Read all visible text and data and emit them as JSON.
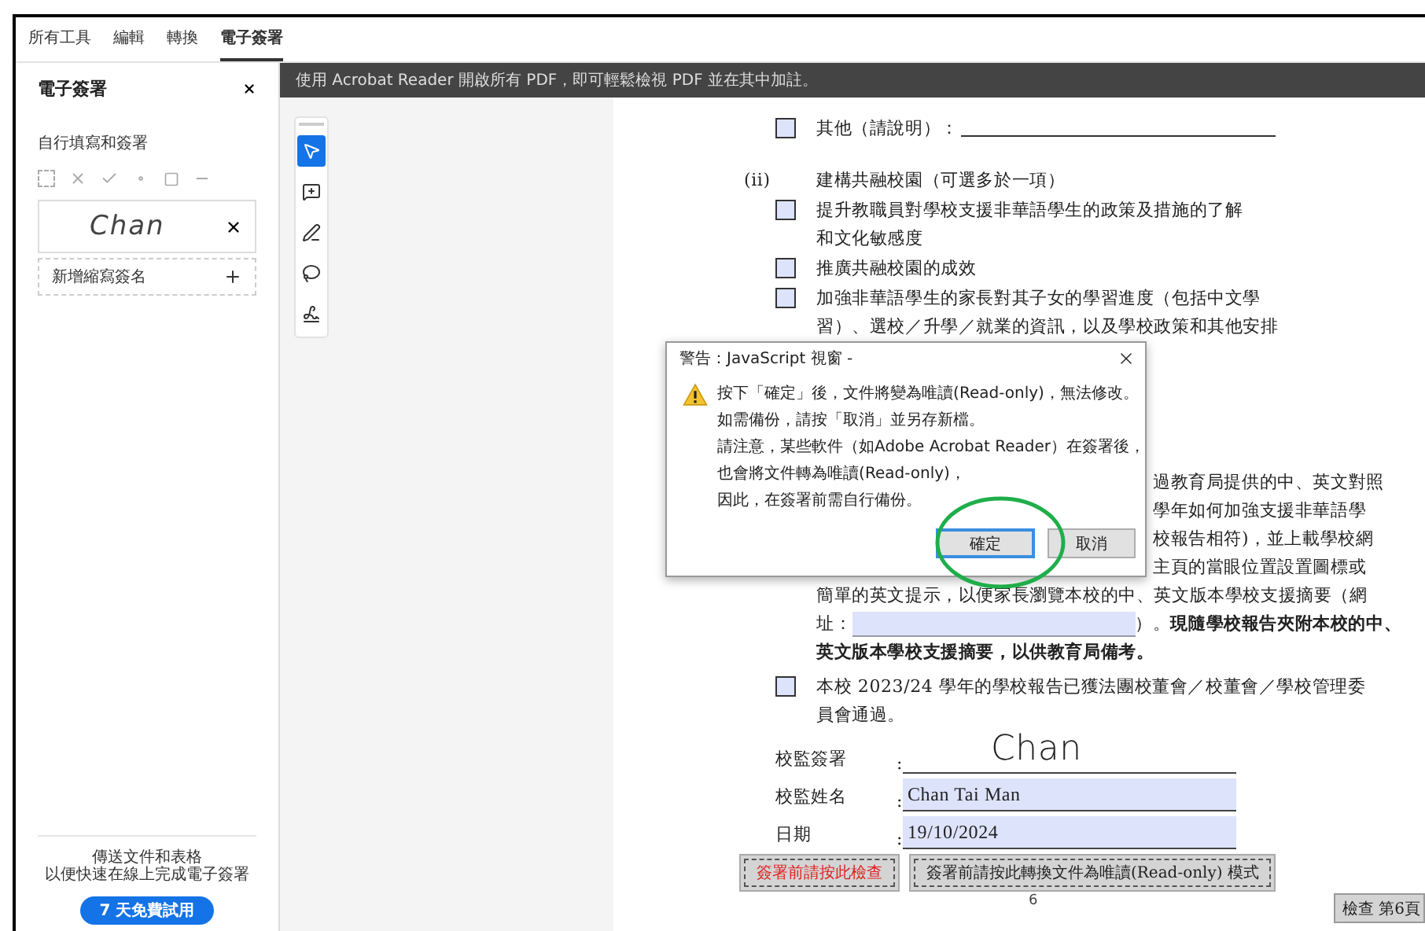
{
  "tabs": [
    {
      "label": "所有工具",
      "selected": false
    },
    {
      "label": "編輯",
      "selected": false
    },
    {
      "label": "轉換",
      "selected": false
    },
    {
      "label": "電子簽署",
      "selected": true
    }
  ],
  "sidebar": {
    "title": "電子簽署",
    "section_label": "自行填寫和簽署",
    "signature": "Chan",
    "add_initials": "新增縮寫簽名",
    "promo_lines": [
      "傳送文件和表格",
      "以便快速在線上完成電子簽署"
    ],
    "trial_button": "7 天免費試用"
  },
  "banner": "使用 Acrobat Reader 開啟所有 PDF，即可輕鬆檢視 PDF 並在其中加註。",
  "tools": [
    {
      "kind": "pointer",
      "selected": true
    },
    {
      "kind": "comment",
      "selected": false
    },
    {
      "kind": "pen",
      "selected": false
    },
    {
      "kind": "lasso",
      "selected": false
    },
    {
      "kind": "sign",
      "selected": false
    }
  ],
  "document": {
    "items": [
      {
        "kind": "checkbox",
        "checked": false,
        "lines": [
          "其他（請說明）："
        ],
        "fill_line": true
      },
      {
        "kind": "heading",
        "marker": "(ii)",
        "text": "建構共融校園（可選多於一項）"
      },
      {
        "kind": "checkbox",
        "checked": false,
        "lines": [
          "提升教職員對學校支援非華語學生的政策及措施的了解",
          "和文化敏感度"
        ]
      },
      {
        "kind": "checkbox",
        "checked": false,
        "lines": [
          "推廣共融校園的成效"
        ]
      },
      {
        "kind": "checkbox",
        "checked": false,
        "lines": [
          "加強非華語學生的家長對其子女的學習進度（包括中文學",
          "習）、選校／升學／就業的資訊，以及學校政策和其他安排"
        ]
      },
      {
        "kind": "fragment",
        "text": "過教育局提供的中、英文對照"
      },
      {
        "kind": "fragment",
        "text": "學年如何加強支援非華語學"
      },
      {
        "kind": "fragment",
        "text": "校報告相符)，並上載學校網"
      },
      {
        "kind": "fragment",
        "text": "主頁的當眼位置設置圖標或"
      },
      {
        "kind": "text",
        "text": "簡單的英文提示，以便家長瀏覽本校的中、英文版本學校支援摘要（網",
        "bold": false
      },
      {
        "kind": "url_line",
        "prefix": "址：",
        "suffix": "）。**現隨學校報告夾附本校的中、**"
      },
      {
        "kind": "text",
        "text": "英文版本學校支援摘要，以供教育局備考。",
        "bold": true
      },
      {
        "kind": "checkbox",
        "checked": false,
        "lines": [
          "本校 2023/24 學年的學校報告已獲法團校董會／校董會／學校管理委",
          "員會通過。"
        ]
      }
    ],
    "fields": [
      {
        "kind": "signature",
        "label": "校監簽署",
        "separator": ":",
        "value": "Chan"
      },
      {
        "kind": "text",
        "label": "校監姓名",
        "separator": ":",
        "value": "Chan Tai Man"
      },
      {
        "kind": "text",
        "label": "日期",
        "separator": ":",
        "value": "19/10/2024"
      }
    ],
    "buttons": [
      {
        "label": "簽署前請按此檢查",
        "kind": "warning"
      },
      {
        "label": "簽署前請按此轉換文件為唯讀(Read-only) 模式",
        "kind": "normal"
      }
    ],
    "page_number": "6",
    "page_check": "檢查 第6頁"
  },
  "dialog": {
    "title": "警告：JavaScript 視窗 -",
    "messages": [
      "按下「確定」後，文件將變為唯讀(Read-only)，無法修改。",
      "如需備份，請按「取消」並另存新檔。",
      "請注意，某些軟件（如Adobe Acrobat Reader）在簽署後，",
      "也會將文件轉為唯讀(Read-only)，",
      "因此，在簽署前需自行備份。"
    ],
    "buttons": [
      {
        "label": "確定",
        "focused": true
      },
      {
        "label": "取消",
        "focused": false
      }
    ]
  }
}
